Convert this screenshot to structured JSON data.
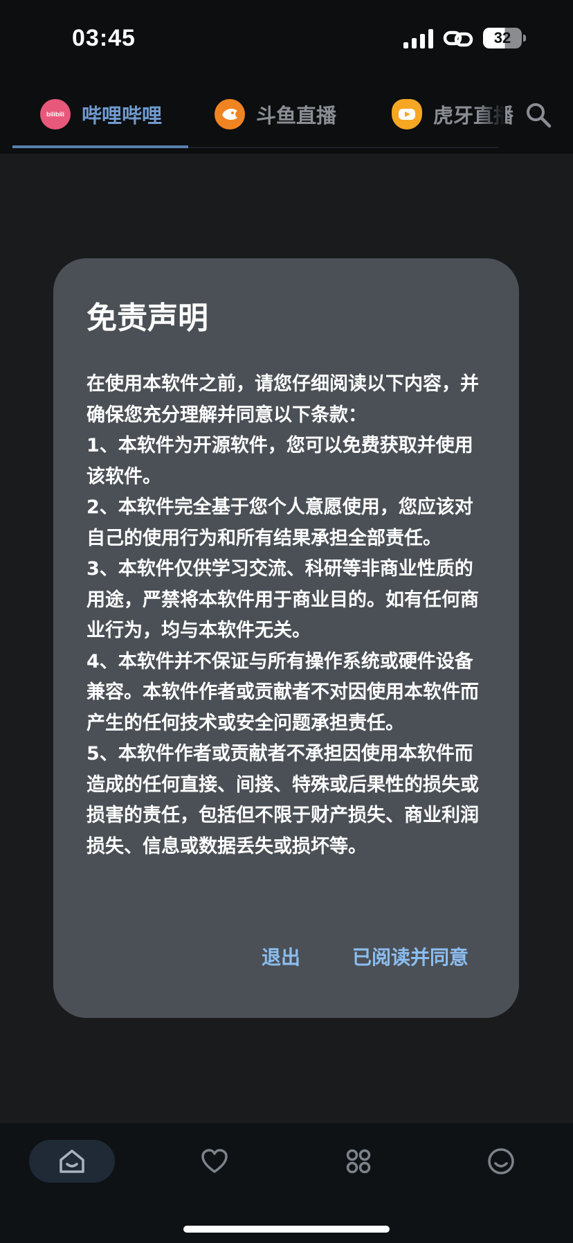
{
  "status_bar": {
    "time": "03:45",
    "battery_level": "32",
    "battery_fraction": 0.32,
    "icons": [
      "signal-icon",
      "link-icon",
      "battery-icon"
    ]
  },
  "tabs": [
    {
      "label": "哔哩哔哩",
      "logo_text": "bilibili",
      "logo_color": "#e8587a",
      "active": true
    },
    {
      "label": "斗鱼直播",
      "logo_color": "#f08422",
      "active": false
    },
    {
      "label": "虎牙直播",
      "logo_color": "#f5a623",
      "active": false
    }
  ],
  "search": {
    "icon": "search-icon"
  },
  "dialog": {
    "title": "免责声明",
    "paragraphs": [
      "在使用本软件之前，请您仔细阅读以下内容，并确保您充分理解并同意以下条款：",
      "1、本软件为开源软件，您可以免费获取并使用该软件。",
      "2、本软件完全基于您个人意愿使用，您应该对自己的使用行为和所有结果承担全部责任。",
      "3、本软件仅供学习交流、科研等非商业性质的用途，严禁将本软件用于商业目的。如有任何商业行为，均与本软件无关。",
      "4、本软件并不保证与所有操作系统或硬件设备兼容。本软件作者或贡献者不对因使用本软件而产生的任何技术或安全问题承担责任。",
      "5、本软件作者或贡献者不承担因使用本软件而造成的任何直接、间接、特殊或后果性的损失或损害的责任，包括但不限于财产损失、商业利润损失、信息或数据丢失或损坏等。"
    ],
    "exit_label": "退出",
    "agree_label": "已阅读并同意"
  },
  "bottom_nav": [
    {
      "icon": "home-icon",
      "active": true
    },
    {
      "icon": "heart-icon",
      "active": false
    },
    {
      "icon": "grid-icon",
      "active": false
    },
    {
      "icon": "smile-icon",
      "active": false
    }
  ],
  "colors": {
    "accent": "#6f9ad0",
    "dialog_bg": "#4b5056",
    "dialog_button": "#8cbef0"
  }
}
